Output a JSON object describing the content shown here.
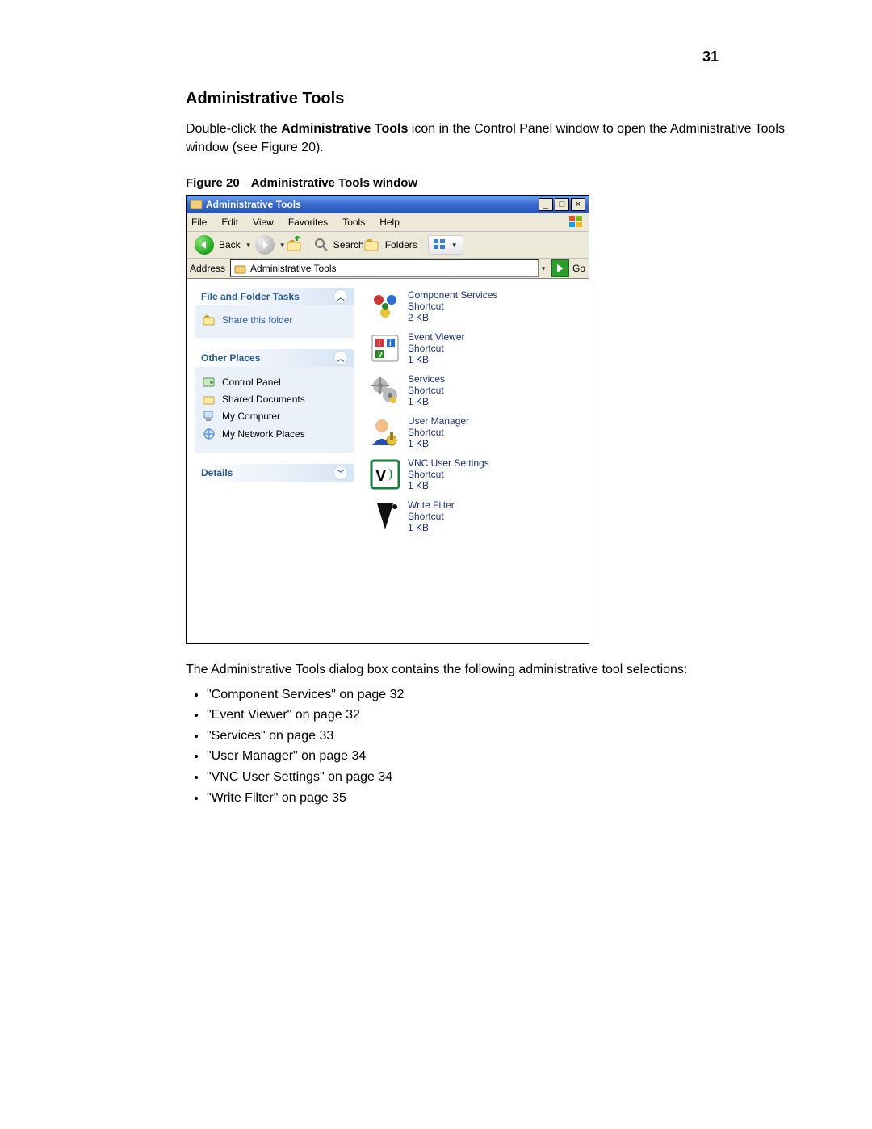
{
  "page": {
    "number": "31",
    "heading": "Administrative Tools",
    "intro_prefix": "Double-click the ",
    "intro_bold": "Administrative Tools",
    "intro_suffix": " icon in the Control Panel window to open the Administrative Tools window (see Figure 20).",
    "figure_label": "Figure 20",
    "figure_title": "Administrative Tools window",
    "after_figure": "The Administrative Tools dialog box contains the following administrative tool selections:",
    "bullets": [
      "\"Component Services\" on page 32",
      "\"Event Viewer\" on page 32",
      "\"Services\" on page 33",
      "\"User Manager\" on page 34",
      "\"VNC User Settings\" on page 34",
      "\"Write Filter\" on page 35"
    ]
  },
  "window": {
    "title": "Administrative Tools",
    "win_min": "_",
    "win_max": "□",
    "win_close": "×",
    "menu": [
      "File",
      "Edit",
      "View",
      "Favorites",
      "Tools",
      "Help"
    ],
    "toolbar": {
      "back": "Back",
      "search": "Search",
      "folders": "Folders"
    },
    "address": {
      "label": "Address",
      "value": "Administrative Tools",
      "go": "Go"
    },
    "panels": {
      "tasks": {
        "title": "File and Folder Tasks",
        "items": [
          "Share this folder"
        ]
      },
      "places": {
        "title": "Other Places",
        "items": [
          "Control Panel",
          "Shared Documents",
          "My Computer",
          "My Network Places"
        ]
      },
      "details": {
        "title": "Details"
      }
    },
    "items": [
      {
        "name": "Component Services",
        "type": "Shortcut",
        "size": "2 KB"
      },
      {
        "name": "Event Viewer",
        "type": "Shortcut",
        "size": "1 KB"
      },
      {
        "name": "Services",
        "type": "Shortcut",
        "size": "1 KB"
      },
      {
        "name": "User Manager",
        "type": "Shortcut",
        "size": "1 KB"
      },
      {
        "name": "VNC User Settings",
        "type": "Shortcut",
        "size": "1 KB"
      },
      {
        "name": "Write Filter",
        "type": "Shortcut",
        "size": "1 KB"
      }
    ]
  }
}
